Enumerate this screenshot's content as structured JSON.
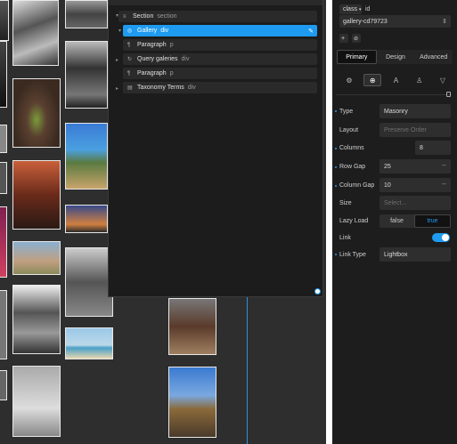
{
  "structure": {
    "rows": [
      {
        "name": "Section",
        "tag": "section",
        "icon": "≡"
      },
      {
        "name": "Gallery",
        "tag": "div",
        "icon": "◎"
      },
      {
        "name": "Paragraph",
        "tag": "p",
        "icon": "¶"
      },
      {
        "name": "Query galeries",
        "tag": "div",
        "icon": "↻"
      },
      {
        "name": "Paragraph",
        "tag": "p",
        "icon": "¶"
      },
      {
        "name": "Taxonomy Terms",
        "tag": "div",
        "icon": "▤"
      }
    ],
    "edit_icon": "✎"
  },
  "panel": {
    "class_label": "class",
    "id_label": "id",
    "selector_value": "gallery-cd79723",
    "add_label": "+",
    "tabs": [
      "Primary",
      "Design",
      "Advanced"
    ],
    "icons": [
      "gear-list-icon",
      "target-icon",
      "typography-icon",
      "shirt-icon",
      "filter-icon"
    ],
    "properties": {
      "type_label": "Type",
      "type_value": "Masonry",
      "layout_label": "Layout",
      "layout_placeholder": "Preserve Order",
      "columns_label": "Columns",
      "columns_value": "8",
      "rowgap_label": "Row Gap",
      "rowgap_value": "25",
      "rowgap_unit": "--",
      "colgap_label": "Column Gap",
      "colgap_value": "10",
      "colgap_unit": "--",
      "size_label": "Size",
      "size_placeholder": "Select...",
      "lazy_label": "Lazy Load",
      "lazy_false": "false",
      "lazy_true": "true",
      "link_label": "Link",
      "link_on": true,
      "linktype_label": "Link Type",
      "linktype_value": "Lightbox"
    }
  },
  "colors": {
    "accent": "#1e9bf0",
    "panel": "#1d1d1d",
    "canvas": "#2e2e2e"
  }
}
